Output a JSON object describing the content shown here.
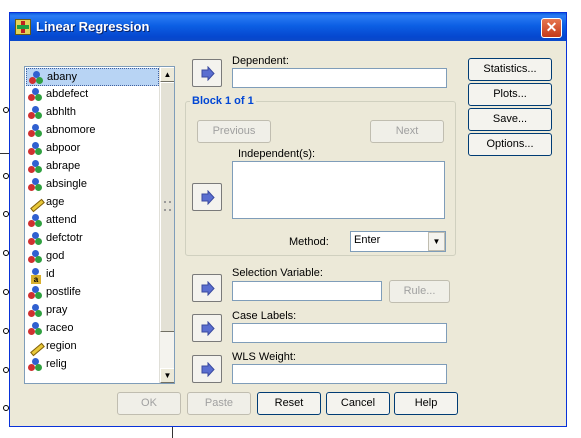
{
  "window": {
    "title": "Linear Regression",
    "close_glyph": "✕"
  },
  "variables": [
    {
      "name": "abany",
      "icon": "nominal-icon",
      "selected": true
    },
    {
      "name": "abdefect",
      "icon": "nominal-icon"
    },
    {
      "name": "abhlth",
      "icon": "nominal-icon"
    },
    {
      "name": "abnomore",
      "icon": "nominal-icon"
    },
    {
      "name": "abpoor",
      "icon": "nominal-icon"
    },
    {
      "name": "abrape",
      "icon": "nominal-icon"
    },
    {
      "name": "absingle",
      "icon": "nominal-icon"
    },
    {
      "name": "age",
      "icon": "scale-icon"
    },
    {
      "name": "attend",
      "icon": "nominal-icon"
    },
    {
      "name": "defctotr",
      "icon": "nominal-icon"
    },
    {
      "name": "god",
      "icon": "nominal-icon"
    },
    {
      "name": "id",
      "icon": "string-icon"
    },
    {
      "name": "postlife",
      "icon": "nominal-icon"
    },
    {
      "name": "pray",
      "icon": "nominal-icon"
    },
    {
      "name": "raceo",
      "icon": "nominal-icon"
    },
    {
      "name": "region",
      "icon": "scale-icon"
    },
    {
      "name": "relig",
      "icon": "nominal-icon"
    }
  ],
  "fields": {
    "dependent_label": "Dependent:",
    "block_title": "Block 1 of 1",
    "previous": "Previous",
    "next": "Next",
    "independent_label": "Independent(s):",
    "method_label": "Method:",
    "method_value": "Enter",
    "selection_label": "Selection Variable:",
    "rule": "Rule...",
    "case_labels_label": "Case Labels:",
    "wls_label": "WLS Weight:"
  },
  "side_buttons": {
    "statistics": "Statistics...",
    "plots": "Plots...",
    "save": "Save...",
    "options": "Options..."
  },
  "bottom_buttons": {
    "ok": "OK",
    "paste": "Paste",
    "reset": "Reset",
    "cancel": "Cancel",
    "help": "Help"
  },
  "colors": {
    "title_bar": "#0a5ddf",
    "group_title": "#0046d5",
    "selection": "#b8d4f4"
  }
}
